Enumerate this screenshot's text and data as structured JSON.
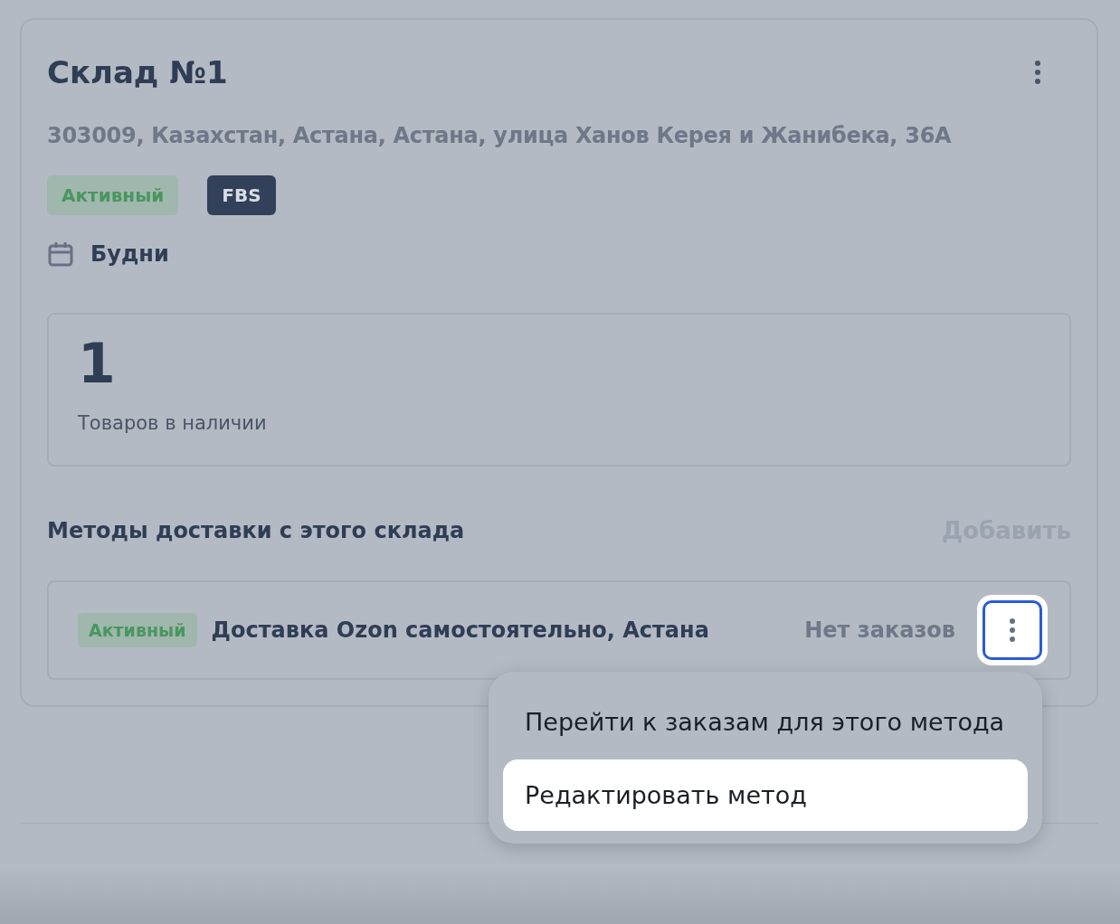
{
  "warehouse": {
    "title": "Склад №1",
    "address": "303009, Казахстан, Астана, Астана, улица Ханов Керея и Жанибека, 36А",
    "badges": [
      {
        "label": "Активный",
        "kind": "status"
      },
      {
        "label": "FBS",
        "kind": "scheme"
      }
    ],
    "schedule": "Будни",
    "stock": {
      "count": "1",
      "label": "Товаров в наличии"
    }
  },
  "delivery": {
    "title": "Методы доставки с этого склада",
    "add_label": "Добавить",
    "methods": [
      {
        "status": "Активный",
        "name": "Доставка Ozon самостоятельно, Астана",
        "orders": "Нет заказов",
        "menu_open": true
      }
    ]
  },
  "menu": [
    {
      "label": "Перейти к заказам для этого метода",
      "selected": false
    },
    {
      "label": "Редактировать метод",
      "selected": true
    }
  ]
}
